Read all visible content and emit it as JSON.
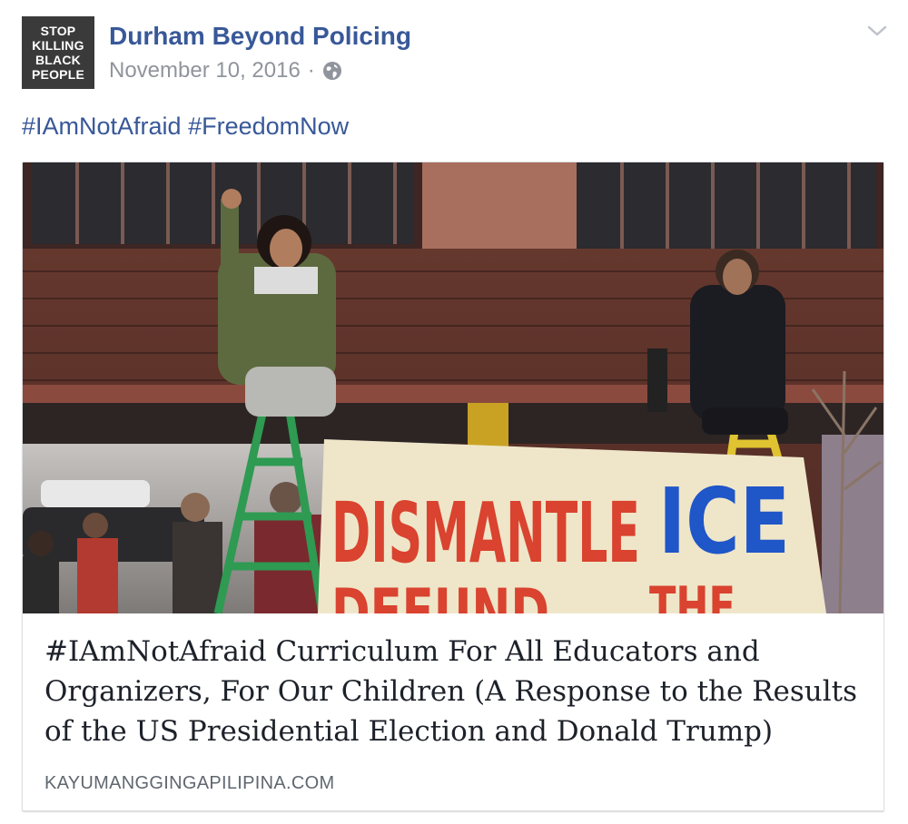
{
  "post": {
    "avatar_text": [
      "STOP",
      "KILLING",
      "BLACK",
      "PEOPLE"
    ],
    "page_name": "Durham Beyond Policing",
    "date": "November 10, 2016",
    "separator": "·",
    "hashtags": [
      "#IAmNotAfraid",
      "#FreedomNow"
    ]
  },
  "link_card": {
    "image": {
      "banner_text_1": "DISMANTLE",
      "banner_text_2": "ICE",
      "banner_text_3": "DEFUND",
      "banner_text_4": "THE"
    },
    "title": "#IAmNotAfraid Curriculum For All Educators and Organizers, For Our Children (A Response to the Results of the US Presidential Election and Donald Trump)",
    "domain": "KAYUMANGGINGAPILIPINA.COM"
  },
  "colors": {
    "link": "#385898",
    "meta": "#90949c",
    "title": "#1d2129",
    "domain": "#606770"
  },
  "icons": [
    "globe-icon",
    "chevron-down-icon"
  ]
}
